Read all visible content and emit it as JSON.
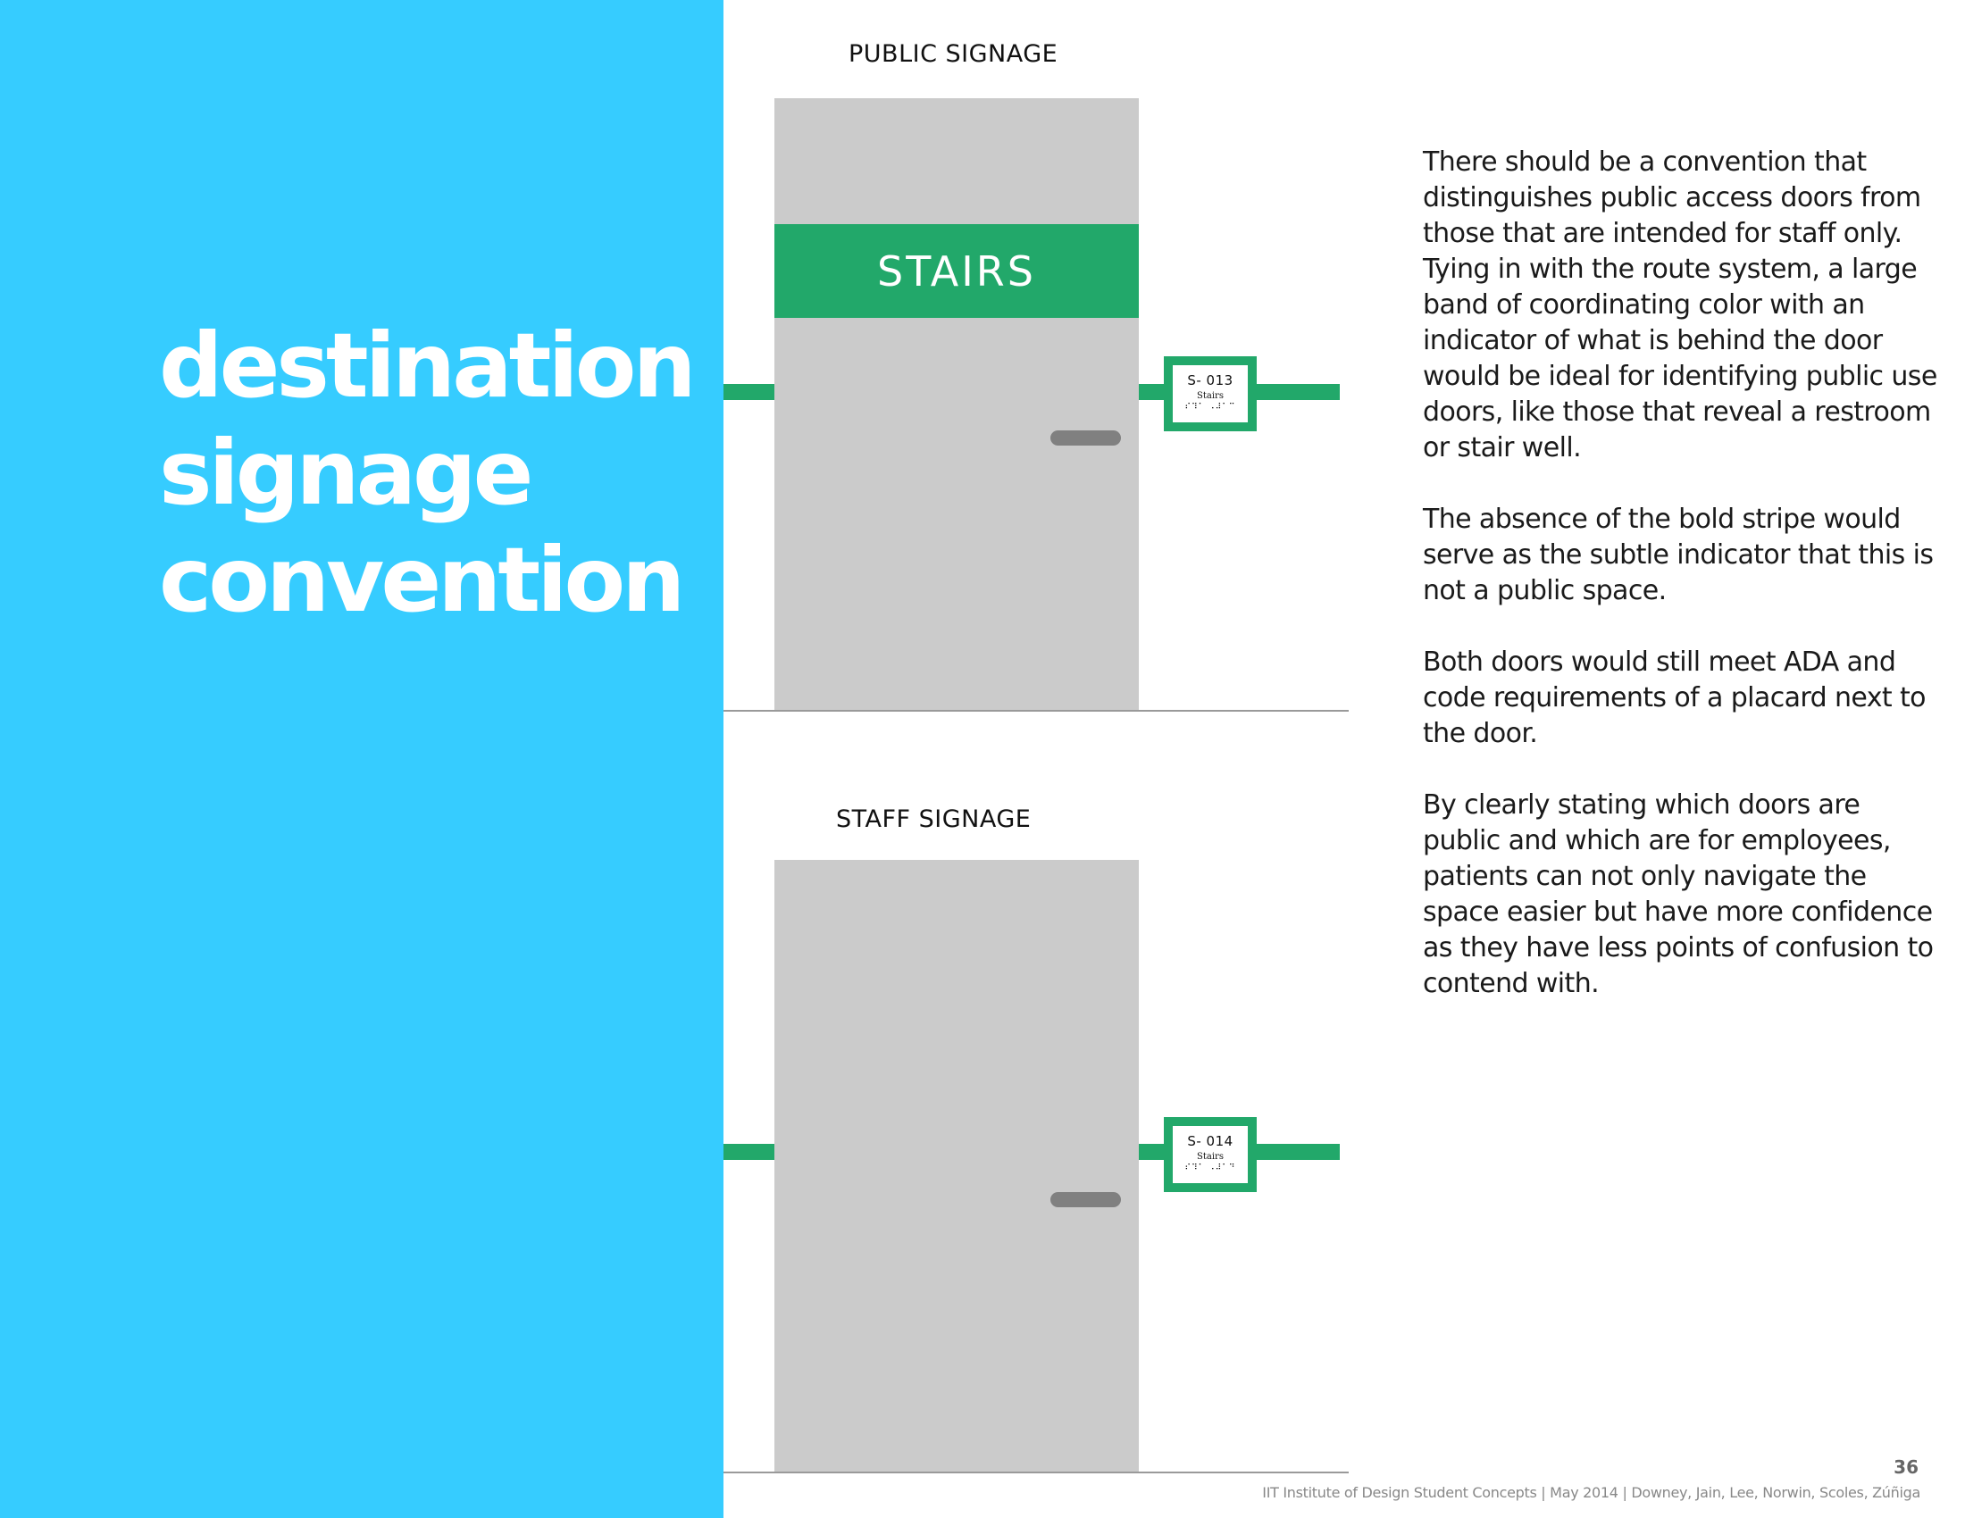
{
  "title": {
    "lines": [
      "destination",
      "signage",
      "convention"
    ]
  },
  "public_section": {
    "label": "PUBLIC SIGNAGE",
    "band_text": "STAIRS",
    "placard": {
      "number": "S- 013",
      "name": "Stairs",
      "braille": "⠎⠹⠁ ⠠⠼⠁⠉"
    }
  },
  "staff_section": {
    "label": "STAFF SIGNAGE",
    "placard": {
      "number": "S- 014",
      "name": "Stairs",
      "braille": "⠎⠹⠁ ⠠⠼⠁⠙"
    }
  },
  "body": {
    "paragraphs": [
      "There should be a convention that distinguishes public access doors from those that are intended for staff only.  Tying in with the route system, a large band of coordinating color with an indicator of what is behind the door would be ideal for identifying public use doors, like those that reveal a restroom or stair well.",
      "The absence of the bold stripe would serve as the subtle indicator that this is not a public space.",
      "Both doors would still meet ADA and code requirements of a placard next to the door.",
      "By clearly stating which doors are public and which are for employees, patients can not only navigate the space easier but have more confidence as they have less points of confusion to contend with."
    ]
  },
  "footer": {
    "page_number": "36",
    "credits": "IIT Institute of Design Student Concepts | May 2014 | Downey, Jain, Lee, Norwin, Scoles, Zúñiga"
  },
  "colors": {
    "accent_blue": "#36CCFF",
    "route_green": "#22A86A",
    "door_gray": "#CBCBCB",
    "handle_gray": "#808080"
  }
}
